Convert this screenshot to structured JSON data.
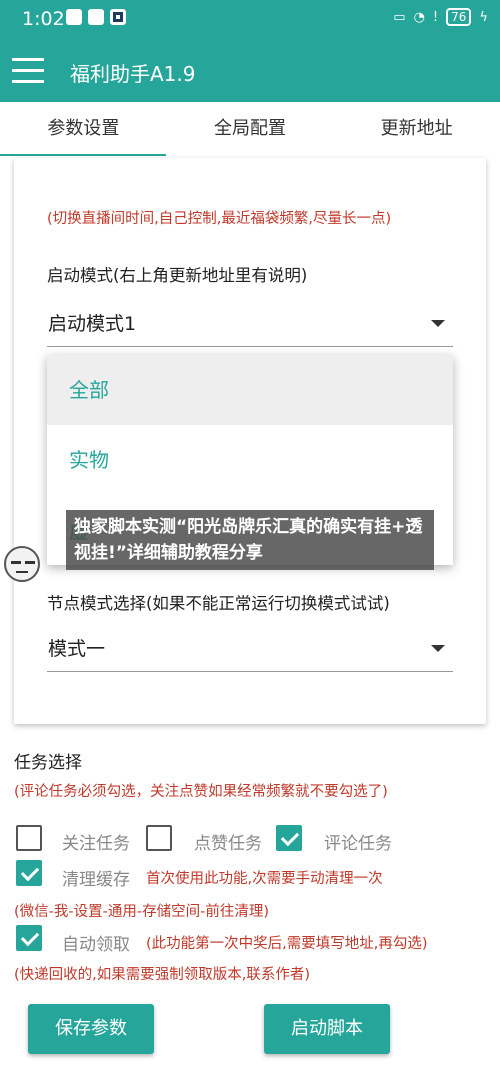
{
  "status": {
    "time": "1:02",
    "battery": "76"
  },
  "app": {
    "title": "福利助手A1.9"
  },
  "tabs": [
    "参数设置",
    "全局配置",
    "更新地址"
  ],
  "card": {
    "hint_top": "(切换直播间时间,自己控制,最近福袋频繁,尽量长一点)",
    "mode_label": "启动模式(右上角更新地址里有说明)",
    "mode_value": "启动模式1",
    "dropdown_options": [
      "全部",
      "实物",
      "虚"
    ],
    "node_label": "节点模式选择(如果不能正常运行切换模式试试)",
    "node_value": "模式一"
  },
  "banner": {
    "text": "独家脚本实测“阳光岛牌乐汇真的确实有挂+透视挂!”详细辅助教程分享"
  },
  "tasks": {
    "title": "任务选择",
    "hint": "(评论任务必须勾选，关注点赞如果经常频繁就不要勾选了)",
    "follow": {
      "label": "关注任务",
      "checked": false
    },
    "like": {
      "label": "点赞任务",
      "checked": false
    },
    "comment": {
      "label": "评论任务",
      "checked": true
    },
    "clear_cache": {
      "label": "清理缓存",
      "checked": true,
      "note": "首次使用此功能,次需要手动清理一次"
    },
    "clear_path": "(微信-我-设置-通用-存储空间-前往清理)",
    "auto_claim": {
      "label": "自动领取",
      "checked": true,
      "note": "(此功能第一次中奖后,需要填写地址,再勾选)"
    },
    "claim_hint": "(快递回收的,如果需要强制领取版本,联系作者)"
  },
  "buttons": {
    "save": "保存参数",
    "start": "启动脚本"
  },
  "colors": {
    "primary": "#26a69a",
    "hint": "#c0392b"
  }
}
